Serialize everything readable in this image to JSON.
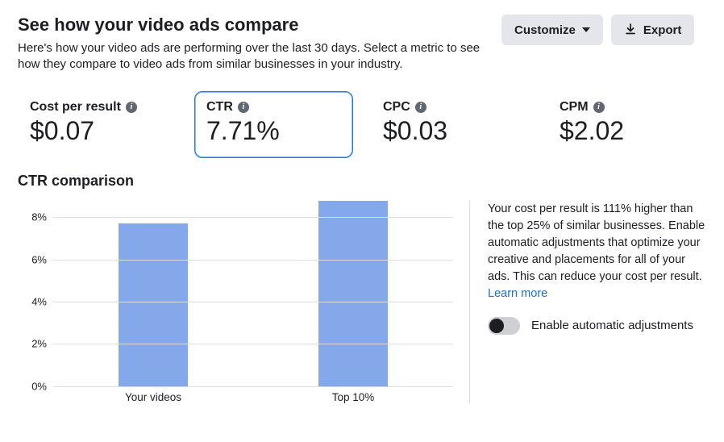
{
  "header": {
    "title": "See how your video ads compare",
    "subtitle": "Here's how your video ads are performing over the last 30 days. Select a metric to see how they compare to video ads from similar businesses in your industry.",
    "customize_label": "Customize",
    "export_label": "Export"
  },
  "metrics": [
    {
      "id": "cpr",
      "label": "Cost per result",
      "value": "$0.07",
      "selected": false
    },
    {
      "id": "ctr",
      "label": "CTR",
      "value": "7.71%",
      "selected": true
    },
    {
      "id": "cpc",
      "label": "CPC",
      "value": "$0.03",
      "selected": false
    },
    {
      "id": "cpm",
      "label": "CPM",
      "value": "$2.02",
      "selected": false
    }
  ],
  "comparison_title": "CTR comparison",
  "chart_data": {
    "type": "bar",
    "categories": [
      "Your videos",
      "Top 10%"
    ],
    "values": [
      7.7,
      8.8
    ],
    "ylabel": "",
    "ylim": [
      0,
      8.8
    ],
    "y_ticks": [
      0,
      2,
      4,
      6,
      8
    ],
    "y_tick_labels": [
      "0%",
      "2%",
      "4%",
      "6%",
      "8%"
    ],
    "bar_color": "#85a8ea"
  },
  "insight": {
    "text": "Your cost per result is 111% higher than the top 25% of similar businesses. Enable automatic adjustments that optimize your creative and placements for all of your ads. This can reduce your cost per result. ",
    "learn_more_label": "Learn more",
    "toggle_label": "Enable automatic adjustments",
    "toggle_on": false
  }
}
